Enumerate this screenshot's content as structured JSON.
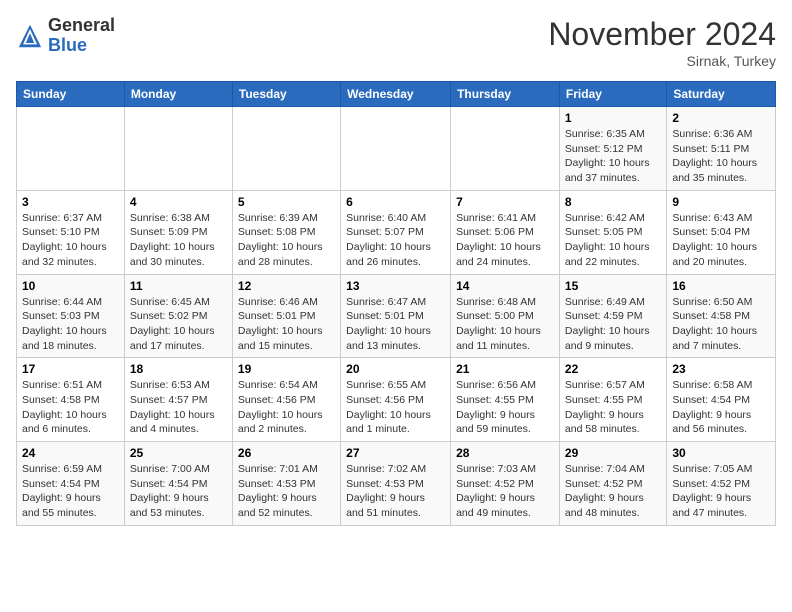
{
  "header": {
    "logo_general": "General",
    "logo_blue": "Blue",
    "month_title": "November 2024",
    "location": "Sirnak, Turkey"
  },
  "weekdays": [
    "Sunday",
    "Monday",
    "Tuesday",
    "Wednesday",
    "Thursday",
    "Friday",
    "Saturday"
  ],
  "weeks": [
    [
      {
        "day": "",
        "info": ""
      },
      {
        "day": "",
        "info": ""
      },
      {
        "day": "",
        "info": ""
      },
      {
        "day": "",
        "info": ""
      },
      {
        "day": "",
        "info": ""
      },
      {
        "day": "1",
        "info": "Sunrise: 6:35 AM\nSunset: 5:12 PM\nDaylight: 10 hours\nand 37 minutes."
      },
      {
        "day": "2",
        "info": "Sunrise: 6:36 AM\nSunset: 5:11 PM\nDaylight: 10 hours\nand 35 minutes."
      }
    ],
    [
      {
        "day": "3",
        "info": "Sunrise: 6:37 AM\nSunset: 5:10 PM\nDaylight: 10 hours\nand 32 minutes."
      },
      {
        "day": "4",
        "info": "Sunrise: 6:38 AM\nSunset: 5:09 PM\nDaylight: 10 hours\nand 30 minutes."
      },
      {
        "day": "5",
        "info": "Sunrise: 6:39 AM\nSunset: 5:08 PM\nDaylight: 10 hours\nand 28 minutes."
      },
      {
        "day": "6",
        "info": "Sunrise: 6:40 AM\nSunset: 5:07 PM\nDaylight: 10 hours\nand 26 minutes."
      },
      {
        "day": "7",
        "info": "Sunrise: 6:41 AM\nSunset: 5:06 PM\nDaylight: 10 hours\nand 24 minutes."
      },
      {
        "day": "8",
        "info": "Sunrise: 6:42 AM\nSunset: 5:05 PM\nDaylight: 10 hours\nand 22 minutes."
      },
      {
        "day": "9",
        "info": "Sunrise: 6:43 AM\nSunset: 5:04 PM\nDaylight: 10 hours\nand 20 minutes."
      }
    ],
    [
      {
        "day": "10",
        "info": "Sunrise: 6:44 AM\nSunset: 5:03 PM\nDaylight: 10 hours\nand 18 minutes."
      },
      {
        "day": "11",
        "info": "Sunrise: 6:45 AM\nSunset: 5:02 PM\nDaylight: 10 hours\nand 17 minutes."
      },
      {
        "day": "12",
        "info": "Sunrise: 6:46 AM\nSunset: 5:01 PM\nDaylight: 10 hours\nand 15 minutes."
      },
      {
        "day": "13",
        "info": "Sunrise: 6:47 AM\nSunset: 5:01 PM\nDaylight: 10 hours\nand 13 minutes."
      },
      {
        "day": "14",
        "info": "Sunrise: 6:48 AM\nSunset: 5:00 PM\nDaylight: 10 hours\nand 11 minutes."
      },
      {
        "day": "15",
        "info": "Sunrise: 6:49 AM\nSunset: 4:59 PM\nDaylight: 10 hours\nand 9 minutes."
      },
      {
        "day": "16",
        "info": "Sunrise: 6:50 AM\nSunset: 4:58 PM\nDaylight: 10 hours\nand 7 minutes."
      }
    ],
    [
      {
        "day": "17",
        "info": "Sunrise: 6:51 AM\nSunset: 4:58 PM\nDaylight: 10 hours\nand 6 minutes."
      },
      {
        "day": "18",
        "info": "Sunrise: 6:53 AM\nSunset: 4:57 PM\nDaylight: 10 hours\nand 4 minutes."
      },
      {
        "day": "19",
        "info": "Sunrise: 6:54 AM\nSunset: 4:56 PM\nDaylight: 10 hours\nand 2 minutes."
      },
      {
        "day": "20",
        "info": "Sunrise: 6:55 AM\nSunset: 4:56 PM\nDaylight: 10 hours\nand 1 minute."
      },
      {
        "day": "21",
        "info": "Sunrise: 6:56 AM\nSunset: 4:55 PM\nDaylight: 9 hours\nand 59 minutes."
      },
      {
        "day": "22",
        "info": "Sunrise: 6:57 AM\nSunset: 4:55 PM\nDaylight: 9 hours\nand 58 minutes."
      },
      {
        "day": "23",
        "info": "Sunrise: 6:58 AM\nSunset: 4:54 PM\nDaylight: 9 hours\nand 56 minutes."
      }
    ],
    [
      {
        "day": "24",
        "info": "Sunrise: 6:59 AM\nSunset: 4:54 PM\nDaylight: 9 hours\nand 55 minutes."
      },
      {
        "day": "25",
        "info": "Sunrise: 7:00 AM\nSunset: 4:54 PM\nDaylight: 9 hours\nand 53 minutes."
      },
      {
        "day": "26",
        "info": "Sunrise: 7:01 AM\nSunset: 4:53 PM\nDaylight: 9 hours\nand 52 minutes."
      },
      {
        "day": "27",
        "info": "Sunrise: 7:02 AM\nSunset: 4:53 PM\nDaylight: 9 hours\nand 51 minutes."
      },
      {
        "day": "28",
        "info": "Sunrise: 7:03 AM\nSunset: 4:52 PM\nDaylight: 9 hours\nand 49 minutes."
      },
      {
        "day": "29",
        "info": "Sunrise: 7:04 AM\nSunset: 4:52 PM\nDaylight: 9 hours\nand 48 minutes."
      },
      {
        "day": "30",
        "info": "Sunrise: 7:05 AM\nSunset: 4:52 PM\nDaylight: 9 hours\nand 47 minutes."
      }
    ]
  ]
}
